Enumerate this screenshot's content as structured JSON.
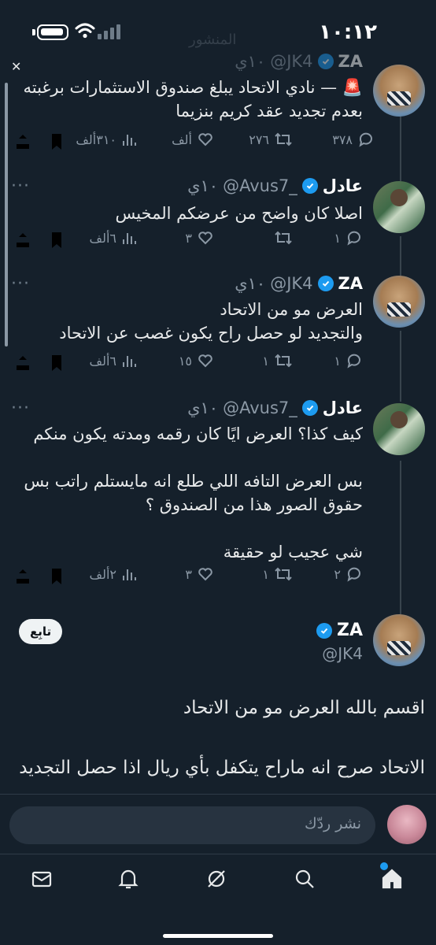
{
  "status_bar": {
    "time": "١٠:١٢"
  },
  "header": {
    "faded_title": "المنشور"
  },
  "tweets": [
    {
      "name": "ZA",
      "handle": "@JK4",
      "time": "١٠ي",
      "text": "🚨 — نادي الاتحاد يبلغ صندوق الاستثمارات برغبته بعدم تجديد عقد كريم بنزيما",
      "replies": "٣٧٨",
      "retweets": "٢٧٦",
      "likes": "ألف",
      "views": "٣١٠ألف"
    },
    {
      "name": "عادل",
      "handle": "@Avus7_",
      "time": "١٠ي",
      "text": "اصلا كان واضح من عرضكم المخيس",
      "replies": "١",
      "retweets": "",
      "likes": "٣",
      "views": "٦ألف"
    },
    {
      "name": "ZA",
      "handle": "@JK4",
      "time": "١٠ي",
      "text": "العرض مو من الاتحاد\nوالتجديد لو حصل راح يكون غصب عن الاتحاد",
      "replies": "١",
      "retweets": "١",
      "likes": "١٥",
      "views": "٦ألف"
    },
    {
      "name": "عادل",
      "handle": "@Avus7_",
      "time": "١٠ي",
      "text": "كيف كذا؟ العرض ايًا كان رقمه ومدته يكون منكم\n\nبس العرض التافه اللي طلع انه مايستلم راتب بس حقوق الصور هذا من الصندوق ؟\n\nشي عجيب لو حقيقة",
      "replies": "٢",
      "retweets": "١",
      "likes": "٣",
      "views": "٢ألف"
    }
  ],
  "focused_tweet": {
    "name": "ZA",
    "handle": "@JK4",
    "follow_label": "تابِع",
    "text": "اقسم بالله العرض مو من الاتحاد\n\nالاتحاد صرح انه ماراح يتكفل بأي ريال اذا حصل التجديد"
  },
  "reply_bar": {
    "placeholder": "نشر ردّك"
  },
  "tabs": [
    "home",
    "search",
    "grok",
    "notifications",
    "messages"
  ],
  "colors": {
    "background": "#15202b",
    "accent": "#1d9bf0",
    "text": "#e7e9ea",
    "muted": "#8b98a5"
  }
}
